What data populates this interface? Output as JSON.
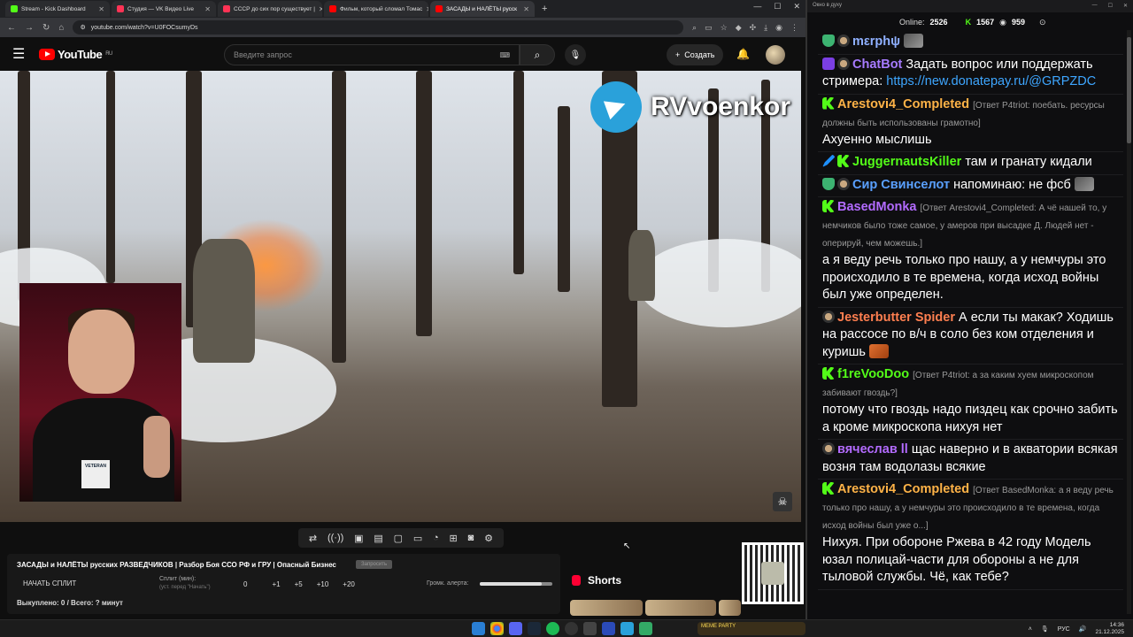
{
  "browser": {
    "tabs": [
      {
        "title": "Stream - Kick Dashboard",
        "color": "#53fc18",
        "active": false
      },
      {
        "title": "Студия — VK Видео Live",
        "color": "#ff3355",
        "active": false
      },
      {
        "title": "СССР до сих пор существует |",
        "color": "#ff3355",
        "active": false
      },
      {
        "title": "Фильм, который сломал Томас",
        "color": "#ff0000",
        "active": false
      },
      {
        "title": "ЗАСАДЫ и НАЛЁТЫ русск",
        "color": "#ff0000",
        "active": true
      }
    ],
    "url": "youtube.com/watch?v=U0FOCsumyDs"
  },
  "youtube": {
    "logo_text": "YouTube",
    "region": "RU",
    "search_placeholder": "Введите запрос",
    "create_label": "Создать"
  },
  "video": {
    "watermark": "RVvoenkor"
  },
  "panel": {
    "title": "ЗАСАДЫ и НАЛЁТЫ русских РАЗВЕДЧИКОВ | Разбор Боя ССО РФ и ГРУ | Опасный Бизнес",
    "badge": "Запросить",
    "split_button": "НАЧАТЬ СПЛИТ",
    "split_label": "Сплит (мин):",
    "split_sub": "(уст. перед \"Начать\")",
    "split_value": "0",
    "increments": [
      "+1",
      "+5",
      "+10",
      "+20"
    ],
    "alert_label": "Громк. алерта:",
    "alert_level": 0.85,
    "footer": "Выкуплено: 0 / Всего: ? минут"
  },
  "shorts": {
    "label": "Shorts"
  },
  "chat": {
    "window_title": "Окно в духу",
    "online_label": "Online:",
    "online_count": "2526",
    "kick_count": "1567",
    "other_count": "959",
    "messages": [
      {
        "user": "mεrphψ",
        "color": "#8fb0ff",
        "reply": "",
        "text": ""
      },
      {
        "user": "ChatBot",
        "color": "#a77bff",
        "reply": "",
        "text": "Задать вопрос или поддержать стримера:",
        "link": "https://new.donatepay.ru/@GRPZDC"
      },
      {
        "user": "Arestovi4_Completed",
        "color": "#ffb347",
        "reply": "[Ответ P4triot: поебать. ресурсы должны быть использованы грамотно]",
        "text": "Ахуенно мыслишь"
      },
      {
        "user": "JuggernautsKiller",
        "color": "#53fc18",
        "reply": "",
        "text": "там и гранату кидали"
      },
      {
        "user": "Сир Свинселот",
        "color": "#5aa0ff",
        "reply": "",
        "text": "напоминаю: не фсб"
      },
      {
        "user": "BasedMonka",
        "color": "#b36bff",
        "reply": "[Ответ Arestovi4_Completed: А чё нашей то, у немчиков было тоже самое, у амеров при высадке Д. Людей нет - оперируй, чем можешь.]",
        "text": "а я веду речь только про нашу, а у немчуры это происходило в те времена, когда исход войны был уже определен."
      },
      {
        "user": "Jesterbutter Spider",
        "color": "#ff7f50",
        "reply": "",
        "text": "А если ты макак? Ходишь на рассосе по в/ч в соло без ком отделения и куришь"
      },
      {
        "user": "f1reVooDoo",
        "color": "#53fc18",
        "reply": "[Ответ P4triot: а за каким хуем микроскопом забивают гвоздь?]",
        "text": "потому что гвоздь надо пиздец как срочно забить а кроме микроскопа нихуя нет"
      },
      {
        "user": "вячеслав ll",
        "color": "#b36bff",
        "reply": "",
        "text": "щас наверно и в акватории всякая возня там водолазы всякие"
      },
      {
        "user": "Arestovi4_Completed",
        "color": "#ffb347",
        "reply": "[Ответ BasedMonka: а я веду речь только про нашу, а у немчуры это происходило в те времена, когда исход войны был уже о...]",
        "text": "Нихуя. При обороне Ржева в 42 году Модель юзал полицай-части для обороны а не для тыловой службы. Чё, как тебе?"
      }
    ]
  },
  "taskbar": {
    "meme_label": "MEME PARTY",
    "lang": "РУС",
    "time": "14:36",
    "date": "21.12.2025"
  }
}
